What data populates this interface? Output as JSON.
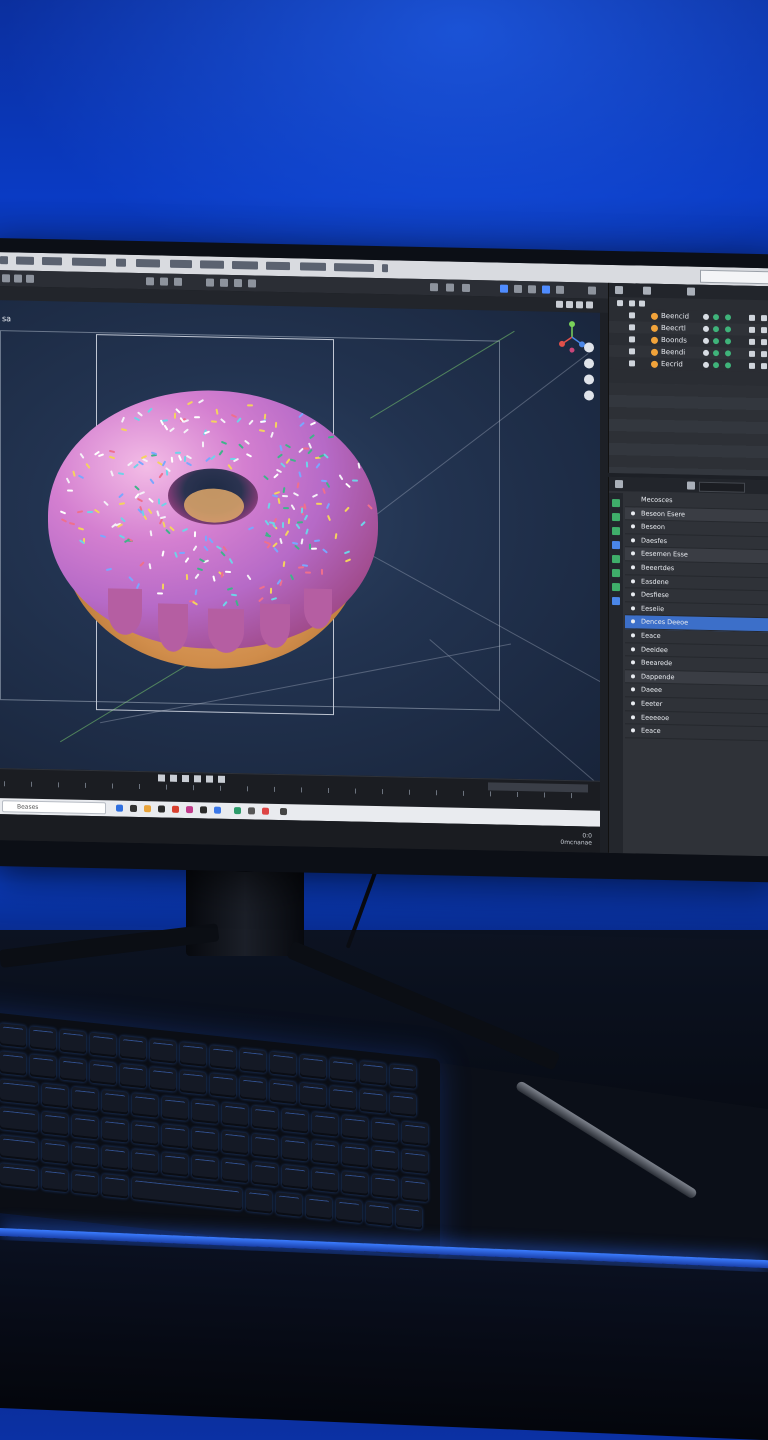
{
  "viewport": {
    "label": "sa"
  },
  "outliner": {
    "rows": [
      {
        "label": "Beencid",
        "dot_color": "#f1a33a"
      },
      {
        "label": "Beecrtl",
        "dot_color": "#f1a33a"
      },
      {
        "label": "Boonds",
        "dot_color": "#f1a33a"
      },
      {
        "label": "Beendi",
        "dot_color": "#f1a33a"
      },
      {
        "label": "Eecrid",
        "dot_color": "#f1a33a"
      }
    ]
  },
  "properties": {
    "header": "Mecosces",
    "items": [
      {
        "label": "Beseon Esere",
        "state": "alt"
      },
      {
        "label": "Beseon",
        "state": "normal"
      },
      {
        "label": "Daesfes",
        "state": "normal"
      },
      {
        "label": "Eesemen Esse",
        "state": "alt"
      },
      {
        "label": "Beeertdes",
        "state": "normal"
      },
      {
        "label": "Easdene",
        "state": "normal"
      },
      {
        "label": "Desfiese",
        "state": "normal"
      },
      {
        "label": "Eeseiie",
        "state": "normal"
      },
      {
        "label": "Dences Deeoe",
        "state": "selected"
      },
      {
        "label": "Eeace",
        "state": "normal"
      },
      {
        "label": "Deeidee",
        "state": "normal"
      },
      {
        "label": "Beearede",
        "state": "normal"
      },
      {
        "label": "Dappende",
        "state": "alt"
      },
      {
        "label": "Daeee",
        "state": "normal"
      },
      {
        "label": "Eeeter",
        "state": "normal"
      },
      {
        "label": "Eeeeeoe",
        "state": "normal"
      },
      {
        "label": "Eeace",
        "state": "normal"
      }
    ]
  },
  "taskbar": {
    "search_label": "Beases"
  },
  "clock": {
    "line1": "0:0",
    "line2": "0mcnanae"
  },
  "colors": {
    "accent": "#3c6fc9",
    "wall": "#0a3bc4",
    "icing": "#c47ad0"
  }
}
